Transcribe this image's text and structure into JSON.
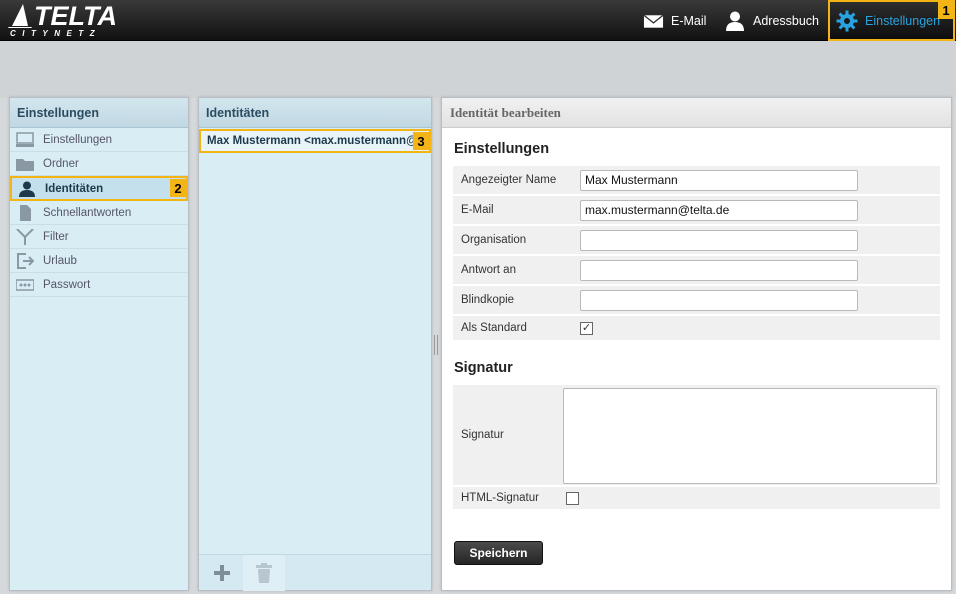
{
  "brand": {
    "name": "TELTA",
    "tagline": "CITYNETZ"
  },
  "topnav": {
    "email": "E-Mail",
    "addressbook": "Adressbuch",
    "settings": "Einstellungen",
    "settings_badge": "1"
  },
  "settings_panel": {
    "title": "Einstellungen",
    "items": [
      {
        "label": "Einstellungen",
        "icon": "monitor-icon"
      },
      {
        "label": "Ordner",
        "icon": "folder-icon"
      },
      {
        "label": "Identitäten",
        "icon": "user-icon",
        "active": true,
        "badge": "2"
      },
      {
        "label": "Schnellantworten",
        "icon": "document-icon"
      },
      {
        "label": "Filter",
        "icon": "filter-icon"
      },
      {
        "label": "Urlaub",
        "icon": "exit-icon"
      },
      {
        "label": "Passwort",
        "icon": "password-icon"
      }
    ]
  },
  "identities_panel": {
    "title": "Identitäten",
    "items": [
      {
        "label": "Max Mustermann <max.mustermann@telta.de>",
        "badge": "3"
      }
    ]
  },
  "edit_panel": {
    "title": "Identität bearbeiten",
    "section_settings": "Einstellungen",
    "fields": [
      {
        "label": "Angezeigter Name",
        "value": "Max Mustermann"
      },
      {
        "label": "E-Mail",
        "value": "max.mustermann@telta.de"
      },
      {
        "label": "Organisation",
        "value": ""
      },
      {
        "label": "Antwort an",
        "value": ""
      },
      {
        "label": "Blindkopie",
        "value": ""
      }
    ],
    "default_label": "Als Standard",
    "default_checked": "✓",
    "section_signature": "Signatur",
    "signature_label": "Signatur",
    "html_signature_label": "HTML-Signatur",
    "save_label": "Speichern"
  },
  "colors": {
    "accent": "#f3b416",
    "active_nav": "#29a3e0",
    "panel_bg": "#d9edf5"
  }
}
